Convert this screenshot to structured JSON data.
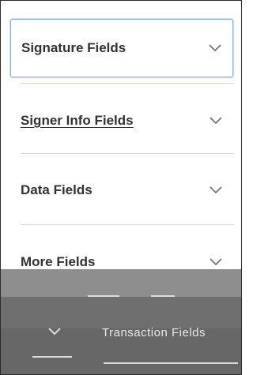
{
  "panel": {
    "items": [
      {
        "label": "Signature Fields",
        "icon": "chevron-down-icon",
        "state": "focused"
      },
      {
        "label": "Signer Info Fields",
        "icon": "chevron-down-icon",
        "state": "hover"
      },
      {
        "label": "Data Fields",
        "icon": "chevron-down-icon",
        "state": "default"
      },
      {
        "label": "More Fields",
        "icon": "chevron-down-icon",
        "state": "default"
      }
    ],
    "overlay_item": {
      "label": "Transaction Fields",
      "icon": "chevron-down-icon"
    }
  },
  "colors": {
    "text": "#323232",
    "chevron": "#6e6e6e",
    "focus_border": "#8ab1e8",
    "divider": "#d9d9d9",
    "overlay": "#7d7d7d"
  }
}
